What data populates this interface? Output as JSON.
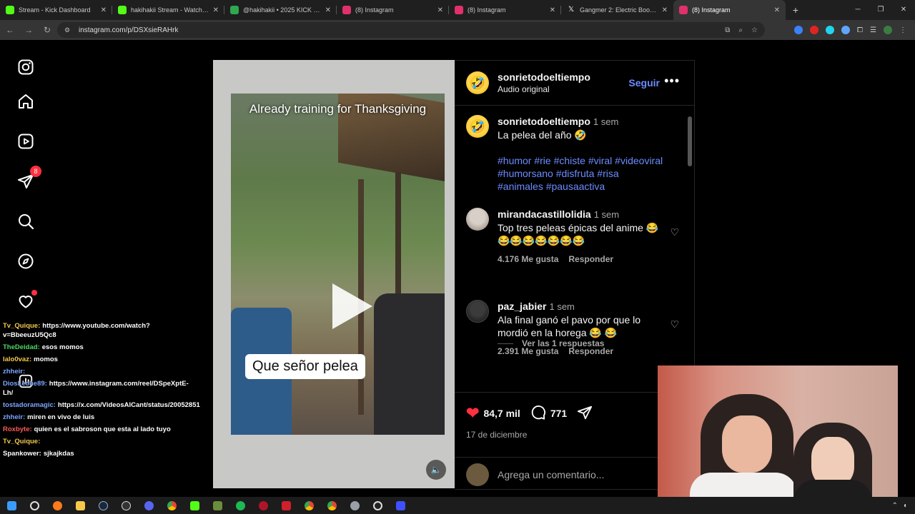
{
  "browser": {
    "tabs": [
      {
        "label": "Stream - Kick Dashboard",
        "icon": "kick-icon",
        "color": "#53fc18"
      },
      {
        "label": "hakihakii Stream - Watch Live o",
        "icon": "kick-icon",
        "color": "#53fc18"
      },
      {
        "label": "@hakihakii • 2025 KICK WRAP",
        "icon": "kick-icon",
        "color": "#2fa84f"
      },
      {
        "label": "(8) Instagram",
        "icon": "instagram-icon",
        "color": "#e1306c"
      },
      {
        "label": "(8) Instagram",
        "icon": "instagram-icon",
        "color": "#e1306c"
      },
      {
        "label": "Gangmer 2: Electric Boogaloo",
        "icon": "x-icon",
        "color": "#ffffff"
      },
      {
        "label": "(8) Instagram",
        "icon": "instagram-icon",
        "color": "#e1306c",
        "active": true
      }
    ],
    "url": "instagram.com/p/DSXsieRAHrk"
  },
  "sidebar": {
    "notifications_badge": "8"
  },
  "chat": [
    {
      "user": "Tv_Quique:",
      "text": "https://www.youtube.com/watch?v=BbeeuzU5Qc8",
      "color": "#f2c94c"
    },
    {
      "user": "TheDeidad:",
      "text": "esos momos",
      "color": "#4cd964"
    },
    {
      "user": "lalo0vaz:",
      "text": "momos",
      "color": "#f2c94c"
    },
    {
      "user": "zhheir:",
      "text": "",
      "color": "#7aa7ff"
    },
    {
      "user": "DiosLeche89:",
      "text": "https://www.instagram.com/reel/DSpeXptE-Lh/",
      "color": "#7aa7ff"
    },
    {
      "user": "tostadoramagic:",
      "text": "https://x.com/VideosAlCant/status/2005285106903048499",
      "color": "#7aa7ff"
    },
    {
      "user": "zhheir:",
      "text": "miren en vivo de luis",
      "color": "#7aa7ff"
    },
    {
      "user": "Roxbyte:",
      "text": "quien es el sabroson que esta al lado tuyo",
      "color": "#ff5a5a"
    },
    {
      "user": "Tv_Quique:",
      "text": "",
      "color": "#f2c94c"
    },
    {
      "user": "Spankower:",
      "text": "sjkajkdas",
      "color": "#ffffff"
    }
  ],
  "video": {
    "title": "Already training for Thanksgiving",
    "caption": "Que señor pelea"
  },
  "post": {
    "author": "sonrietodoeltiempo",
    "audio": "Audio original",
    "follow_label": "Seguir",
    "caption_time": "1 sem",
    "caption": "La pelea del año 🤣",
    "hashtags": "#humor #rie #chiste #viral #videoviral #humorsano #disfruta #risa  #animales #pausaactiva",
    "likes": "84,7 mil",
    "comments_count": "771",
    "date": "17 de diciembre",
    "add_comment_placeholder": "Agrega un comentario..."
  },
  "comments": [
    {
      "user": "mirandacastillolidia",
      "time": "1 sem",
      "text": "Top tres peleas épicas del anime 😂😂😂😂😂😂😂😂",
      "likes": "4.176 Me gusta",
      "reply": "Responder",
      "view_replies": "Ver las 1 respuestas"
    },
    {
      "user": "paz_jabier",
      "time": "1 sem",
      "text": "Ala final ganó el pavo por que lo mordió en la horega 😂 😂",
      "likes": "2.391 Me gusta",
      "reply": "Responder",
      "view_replies": "Ver las 8 respuestas"
    }
  ]
}
